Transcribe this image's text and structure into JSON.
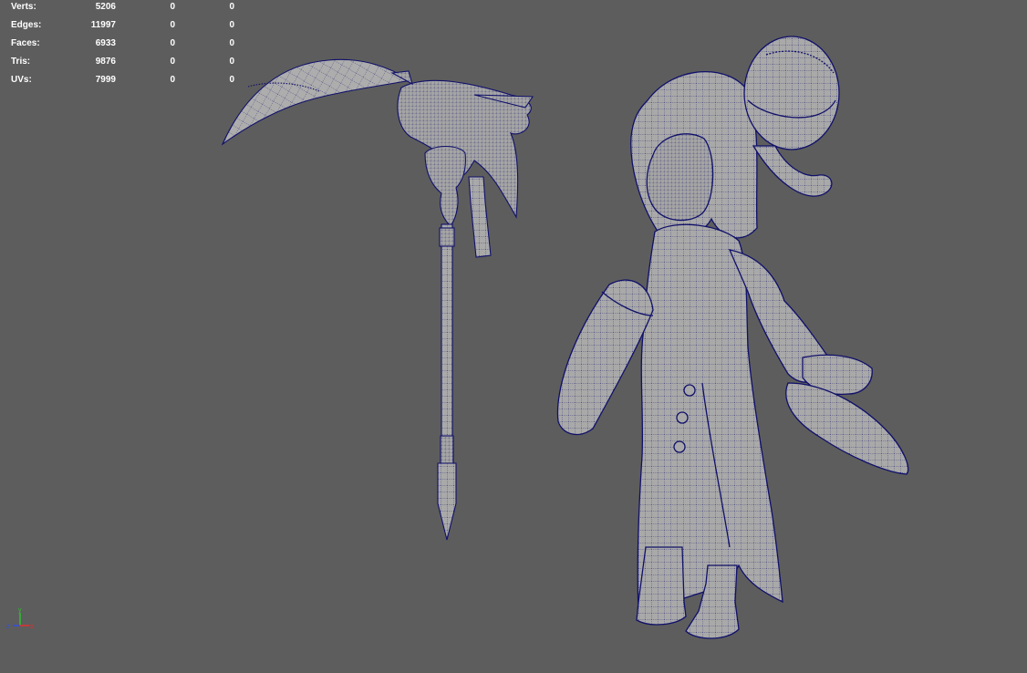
{
  "viewport": {
    "background": "#5d5d5d",
    "wire_color": "#10106a",
    "mesh_color": "#a9a9a9"
  },
  "hud": {
    "rows": [
      {
        "label": "Verts:",
        "v1": "5206",
        "v2": "0",
        "v3": "0"
      },
      {
        "label": "Edges:",
        "v1": "11997",
        "v2": "0",
        "v3": "0"
      },
      {
        "label": "Faces:",
        "v1": "6933",
        "v2": "0",
        "v3": "0"
      },
      {
        "label": "Tris:",
        "v1": "9876",
        "v2": "0",
        "v3": "0"
      },
      {
        "label": "UVs:",
        "v1": "7999",
        "v2": "0",
        "v3": "0"
      }
    ]
  },
  "axis_gizmo": {
    "x_label": "x",
    "y_label": "y",
    "z_label": "z",
    "x_color": "#e03030",
    "y_color": "#30c030",
    "z_color": "#3050e0"
  }
}
